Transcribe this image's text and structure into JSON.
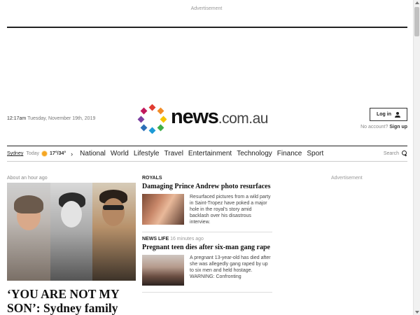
{
  "ads": {
    "top_label": "Advertisement",
    "side_label": "Advertisement"
  },
  "header": {
    "time": "12:17am",
    "date": "Tuesday, November 19th, 2019",
    "logo_main": "news",
    "logo_domain": ".com.au",
    "login_label": "Log in",
    "no_account": "No account?",
    "signup_label": "Sign up"
  },
  "nav": {
    "weather": {
      "city": "Sydney",
      "day": "Today",
      "temps": "17°/34°",
      "icon": "sun-icon"
    },
    "links": [
      "National",
      "World",
      "Lifestyle",
      "Travel",
      "Entertainment",
      "Technology",
      "Finance",
      "Sport"
    ],
    "search_label": "Search"
  },
  "lead_story": {
    "when": "About an hour ago",
    "headline": "‘YOU ARE NOT MY SON’: Sydney family torn"
  },
  "stories": [
    {
      "section": "ROYALS",
      "ago": "",
      "title": "Damaging Prince Andrew photo resurfaces",
      "body": "Resurfaced pictures from a wild party in Saint-Tropez have poked a major hole in the royal's story amid backlash over his disastrous interview."
    },
    {
      "section": "NEWS LIFE",
      "ago": "16 minutes ago",
      "title": "Pregnant teen dies after six-man gang rape",
      "body": "A pregnant 13-year-old has died after she was allegedly gang raped by up to six men and held hostage. WARNING: Confronting"
    }
  ],
  "colors": {
    "logo_dots": [
      "#e03c31",
      "#f28c28",
      "#f5c400",
      "#3fae49",
      "#1d9ad6",
      "#2c6fb7",
      "#7b3fa0",
      "#c2185b"
    ]
  }
}
